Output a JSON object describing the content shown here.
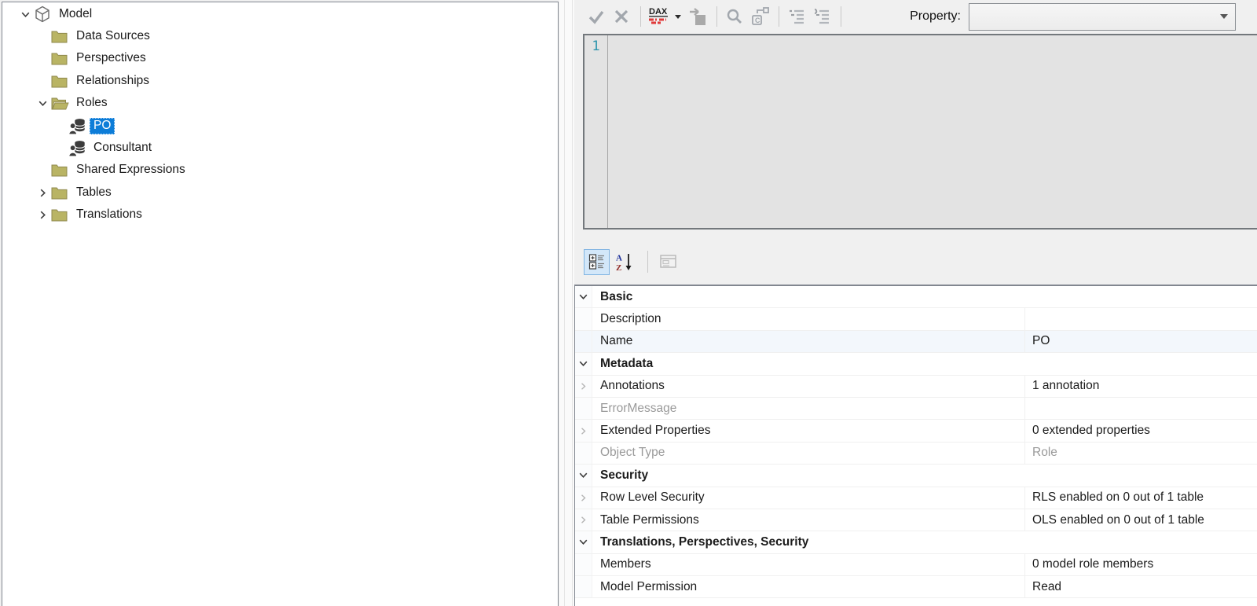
{
  "colors": {
    "accent": "#0d7dd8",
    "folder": "#b9b464",
    "role_icon": "#3c3c3c",
    "line_number": "#2e95ad",
    "panel_border": "#828790"
  },
  "tree": {
    "items": [
      {
        "label": "Model",
        "icon": "model-icon",
        "indent": 0,
        "expander": "expanded"
      },
      {
        "label": "Data Sources",
        "icon": "folder-icon",
        "indent": 1,
        "expander": "none"
      },
      {
        "label": "Perspectives",
        "icon": "folder-icon",
        "indent": 1,
        "expander": "none"
      },
      {
        "label": "Relationships",
        "icon": "folder-icon",
        "indent": 1,
        "expander": "none"
      },
      {
        "label": "Roles",
        "icon": "folder-open-icon",
        "indent": 1,
        "expander": "expanded"
      },
      {
        "label": "PO",
        "icon": "role-icon",
        "indent": 2,
        "expander": "none",
        "selected": true
      },
      {
        "label": "Consultant",
        "icon": "role-icon",
        "indent": 2,
        "expander": "none"
      },
      {
        "label": "Shared Expressions",
        "icon": "folder-icon",
        "indent": 1,
        "expander": "none"
      },
      {
        "label": "Tables",
        "icon": "folder-icon",
        "indent": 1,
        "expander": "collapsed"
      },
      {
        "label": "Translations",
        "icon": "folder-icon",
        "indent": 1,
        "expander": "collapsed"
      }
    ]
  },
  "editor_toolbar": {
    "buttons": [
      {
        "name": "accept-icon",
        "disabled": true
      },
      {
        "name": "cancel-icon",
        "disabled": true
      },
      {
        "name": "separator"
      },
      {
        "name": "dax-formatter-icon"
      },
      {
        "name": "dropdown-caret-icon"
      },
      {
        "name": "paste-icon",
        "disabled": true
      },
      {
        "name": "separator"
      },
      {
        "name": "find-icon"
      },
      {
        "name": "replace-icon"
      },
      {
        "name": "separator"
      },
      {
        "name": "comment-lines-icon"
      },
      {
        "name": "uncomment-lines-icon"
      },
      {
        "name": "separator"
      }
    ],
    "property_label": "Property:",
    "property_value": ""
  },
  "editor": {
    "line_number": "1",
    "content": ""
  },
  "property_toolbar": {
    "buttons": [
      {
        "name": "categorized-icon",
        "active": true
      },
      {
        "name": "alphabetical-sort-icon"
      },
      {
        "name": "separator"
      },
      {
        "name": "property-pages-icon",
        "disabled": true
      }
    ]
  },
  "property_grid": {
    "rows": [
      {
        "type": "category",
        "label": "Basic"
      },
      {
        "type": "property",
        "name": "Description",
        "value": ""
      },
      {
        "type": "property",
        "name": "Name",
        "value": "PO",
        "tint": true
      },
      {
        "type": "category",
        "label": "Metadata"
      },
      {
        "type": "property",
        "name": "Annotations",
        "value": "1 annotation",
        "expandable": true
      },
      {
        "type": "property",
        "name": "ErrorMessage",
        "value": "",
        "readonly": true
      },
      {
        "type": "property",
        "name": "Extended Properties",
        "value": "0 extended properties",
        "expandable": true
      },
      {
        "type": "property",
        "name": "Object Type",
        "value": "Role",
        "readonly": true
      },
      {
        "type": "category",
        "label": "Security"
      },
      {
        "type": "property",
        "name": "Row Level Security",
        "value": "RLS enabled on 0 out of 1 table",
        "expandable": true
      },
      {
        "type": "property",
        "name": "Table Permissions",
        "value": "OLS enabled on 0 out of 1 table",
        "expandable": true
      },
      {
        "type": "category",
        "label": "Translations, Perspectives, Security"
      },
      {
        "type": "property",
        "name": "Members",
        "value": "0 model role members"
      },
      {
        "type": "property",
        "name": "Model Permission",
        "value": "Read"
      }
    ]
  }
}
